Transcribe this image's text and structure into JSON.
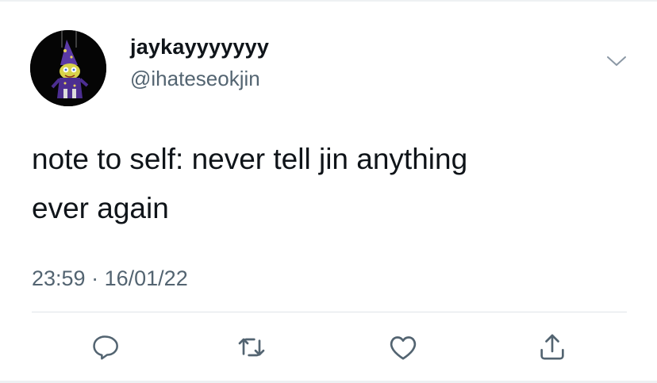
{
  "author": {
    "display_name": "jaykayyyyyyy",
    "handle": "@ihateseokjin",
    "avatar_icon": "avatar-image"
  },
  "tweet": {
    "lines": [
      "note to self: never tell jin anything",
      "ever again"
    ],
    "time": "23:59",
    "separator": "·",
    "date": "16/01/22"
  },
  "actions": [
    {
      "name": "reply",
      "icon": "reply-icon"
    },
    {
      "name": "retweet",
      "icon": "retweet-icon"
    },
    {
      "name": "like",
      "icon": "heart-icon"
    },
    {
      "name": "share",
      "icon": "share-icon"
    }
  ],
  "colors": {
    "text": "#0f1419",
    "secondary": "#536471",
    "icon": "#536471",
    "divider": "#dfe4e8",
    "background": "#ffffff"
  }
}
